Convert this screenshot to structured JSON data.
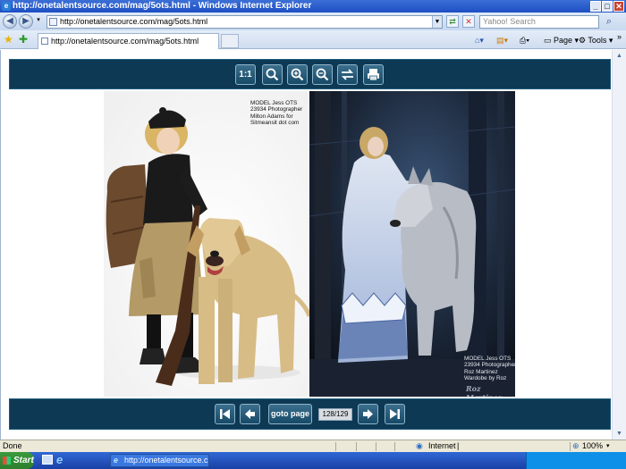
{
  "window": {
    "title": "http://onetalentsource.com/mag/5ots.html - Windows Internet Explorer"
  },
  "address_bar": {
    "url": "http://onetalentsource.com/mag/5ots.html",
    "search_placeholder": "Yahoo! Search"
  },
  "tab": {
    "label": "http://onetalentsource.com/mag/5ots.html"
  },
  "command_bar": {
    "page_label": "Page",
    "tools_label": "Tools"
  },
  "viewer_toolbar": {
    "actual_size_label": "1:1"
  },
  "magazine": {
    "left_credit": "MODEL Jess OTS\n23934 Photographer\nMilton Adams for\nSitmeansit dot com",
    "right_credit": "MODEL Jess OTS\n23934 Photographer\nRoz Martinez\nWardobe by Roz",
    "right_signature": "Roz Martinez"
  },
  "navigation": {
    "goto_label": "goto page",
    "page_indicator": "128/129"
  },
  "status_bar": {
    "status_text": "Done",
    "zone": "Internet",
    "zoom": "100%"
  },
  "taskbar": {
    "start_label": "Start",
    "window_button": "http://onetalentsource.c..."
  }
}
